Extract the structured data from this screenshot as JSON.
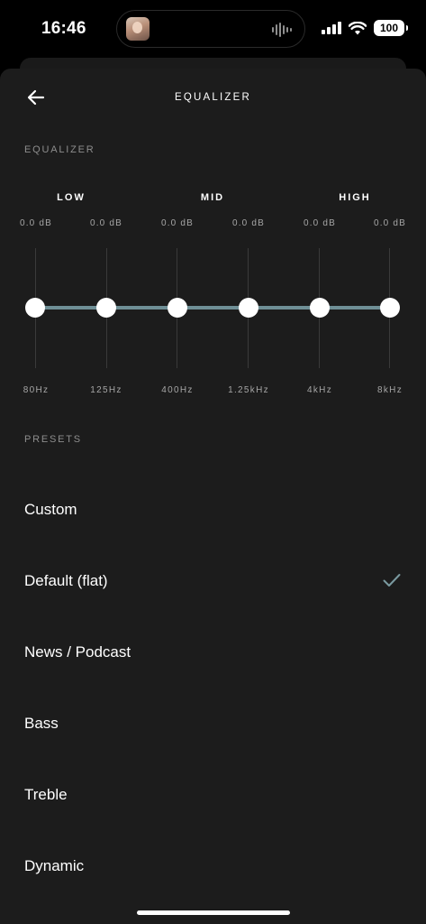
{
  "status_bar": {
    "time": "16:46",
    "battery": "100",
    "icons": [
      "signal-icon",
      "wifi-icon",
      "battery-icon"
    ]
  },
  "header": {
    "title": "EQUALIZER",
    "back_icon": "arrow-left-icon"
  },
  "equalizer": {
    "section_label": "EQUALIZER",
    "groups": [
      "LOW",
      "MID",
      "HIGH"
    ],
    "bands": [
      {
        "freq": "80Hz",
        "gain": "0.0 dB",
        "value": 0.0
      },
      {
        "freq": "125Hz",
        "gain": "0.0 dB",
        "value": 0.0
      },
      {
        "freq": "400Hz",
        "gain": "0.0 dB",
        "value": 0.0
      },
      {
        "freq": "1.25kHz",
        "gain": "0.0 dB",
        "value": 0.0
      },
      {
        "freq": "4kHz",
        "gain": "0.0 dB",
        "value": 0.0
      },
      {
        "freq": "8kHz",
        "gain": "0.0 dB",
        "value": 0.0
      }
    ]
  },
  "presets": {
    "section_label": "PRESETS",
    "items": [
      {
        "label": "Custom",
        "selected": false
      },
      {
        "label": "Default (flat)",
        "selected": true
      },
      {
        "label": "News / Podcast",
        "selected": false
      },
      {
        "label": "Bass",
        "selected": false
      },
      {
        "label": "Treble",
        "selected": false
      },
      {
        "label": "Dynamic",
        "selected": false
      }
    ]
  },
  "colors": {
    "background": "#000000",
    "sheet": "#1c1c1c",
    "eq_line": "#6f8f96",
    "check": "#7a9aa0"
  }
}
